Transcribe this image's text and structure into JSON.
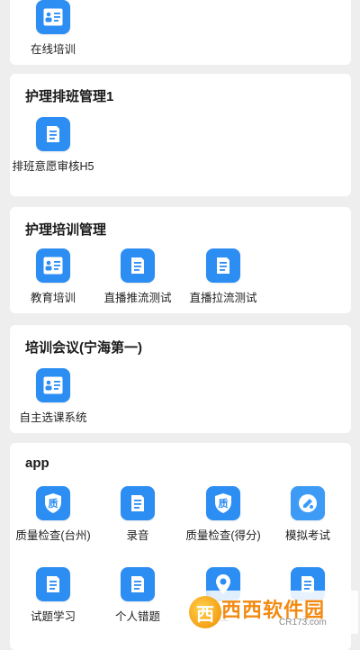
{
  "sections": [
    {
      "title": "",
      "items": [
        {
          "label": "在线培训",
          "icon": "document-card-icon"
        }
      ]
    },
    {
      "title": "护理排班管理1",
      "items": [
        {
          "label": "排班意愿审核H5",
          "icon": "document-list-icon"
        }
      ]
    },
    {
      "title": "护理培训管理",
      "items": [
        {
          "label": "教育培训",
          "icon": "document-card-icon"
        },
        {
          "label": "直播推流测试",
          "icon": "document-list-icon"
        },
        {
          "label": "直播拉流测试",
          "icon": "document-list-icon"
        }
      ]
    },
    {
      "title": "培训会议(宁海第一)",
      "items": [
        {
          "label": "自主选课系统",
          "icon": "document-card-icon"
        }
      ]
    },
    {
      "title": "app",
      "items": [
        {
          "label": "质量检查(台州)",
          "icon": "quality-shield-icon"
        },
        {
          "label": "录音",
          "icon": "document-list-icon"
        },
        {
          "label": "质量检查(得分)",
          "icon": "quality-shield-icon"
        },
        {
          "label": "模拟考试",
          "icon": "exam-icon"
        },
        {
          "label": "试题学习",
          "icon": "document-list-icon"
        },
        {
          "label": "个人错题",
          "icon": "document-list-icon"
        },
        {
          "label": "在",
          "icon": "location-pin-icon"
        },
        {
          "label": "三)",
          "icon": "document-list-icon"
        }
      ]
    }
  ],
  "watermark": {
    "logo_text": "西",
    "text": "西西软件园",
    "url": "CR173.com"
  },
  "colors": {
    "icon_bg": "#2c8df2",
    "card_bg": "#ffffff",
    "page_bg": "#eeeeee"
  }
}
